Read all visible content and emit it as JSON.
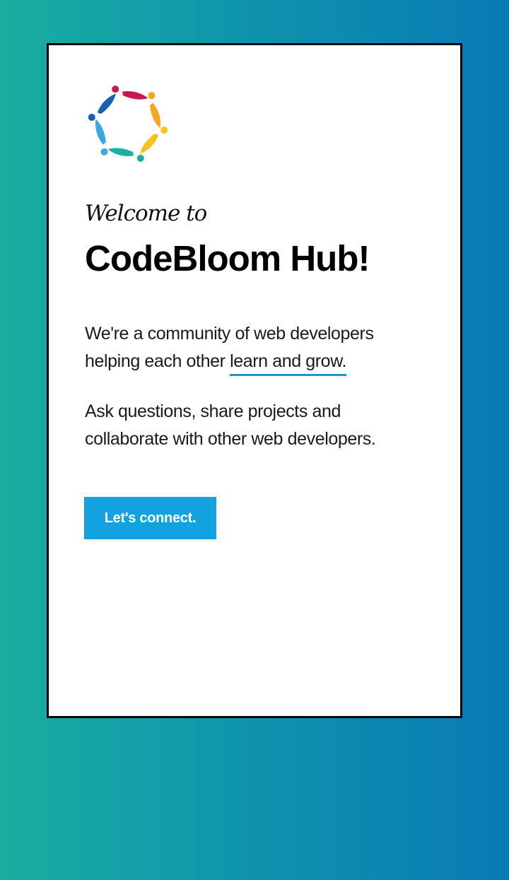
{
  "welcome_text": "Welcome to",
  "title": "CodeBloom Hub!",
  "paragraph1": {
    "before": "We're a community of web developers helping each other ",
    "highlight": "learn and grow."
  },
  "paragraph2": "Ask questions, share projects and collaborate with other web developers.",
  "cta_label": "Let's connect.",
  "logo": {
    "icon": "community-circle-logo",
    "colors": [
      "#c8174a",
      "#f5a623",
      "#f7c21b",
      "#19b0a0",
      "#3aa9e0",
      "#1a5fb4"
    ]
  },
  "colors": {
    "accent": "#12a2e0",
    "underline": "#1a98d0",
    "gradient_start": "#19aea0",
    "gradient_end": "#087ab5"
  }
}
